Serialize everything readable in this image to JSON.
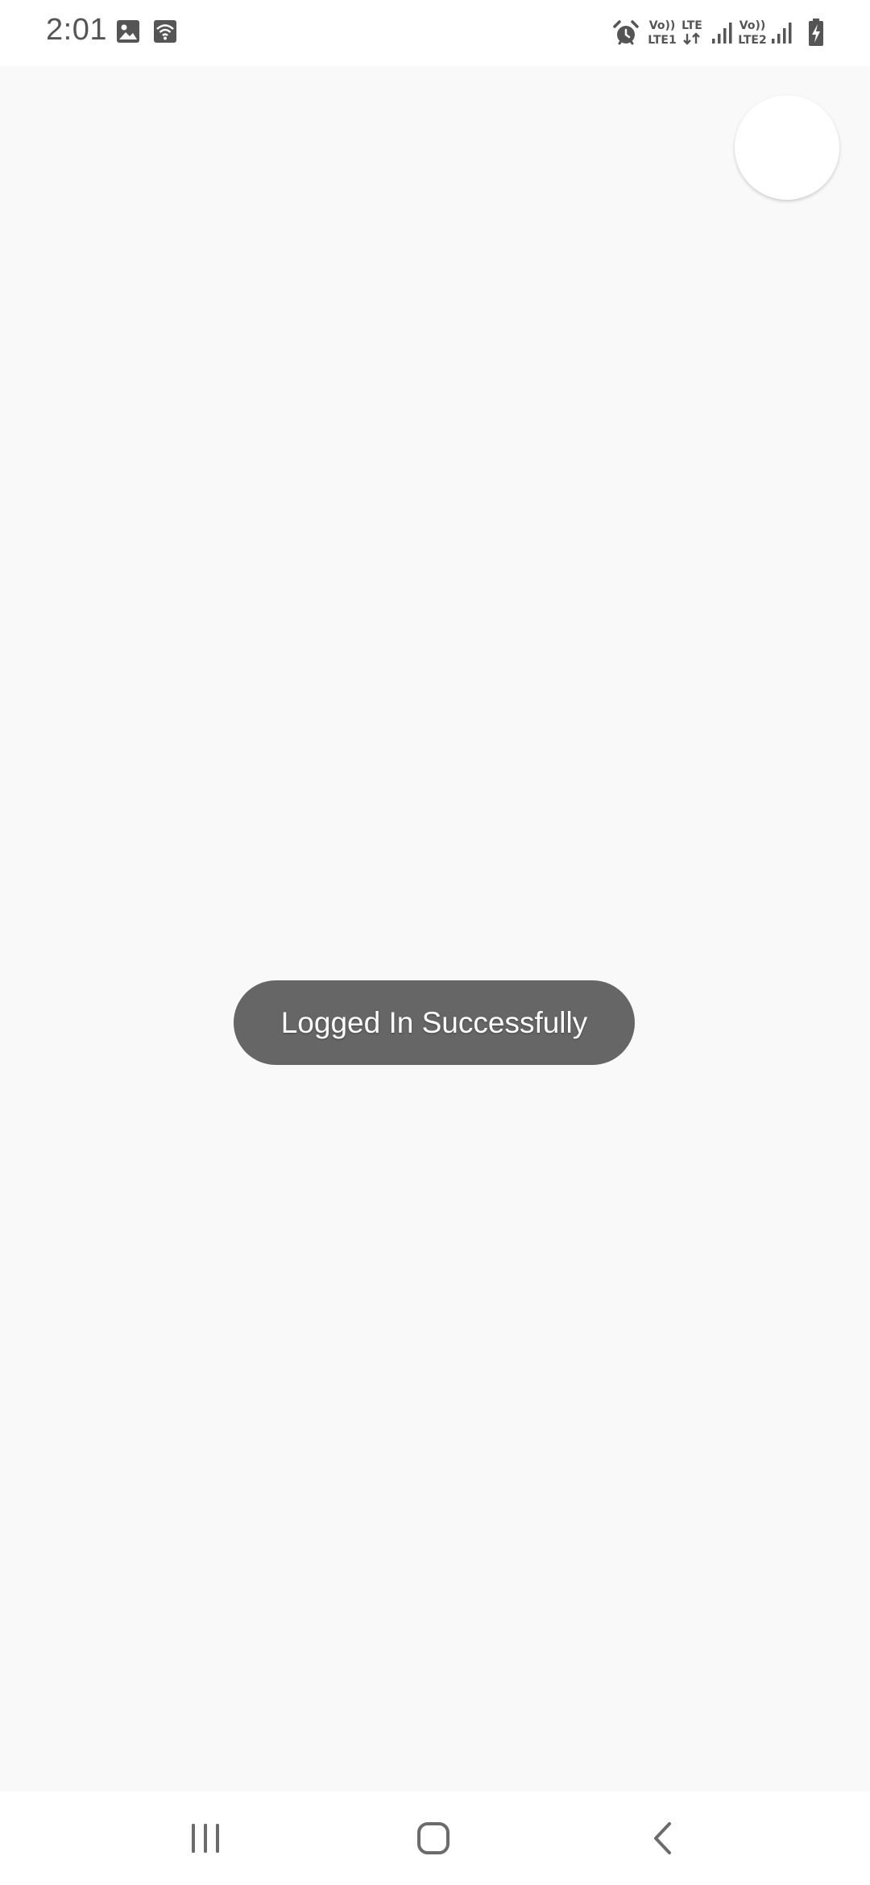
{
  "status_bar": {
    "time": "2:01",
    "left_icons": [
      "image-icon",
      "wifi-calling-icon"
    ],
    "right_icons": [
      "alarm-icon",
      "volte1-icon",
      "lte-data-icon",
      "signal-icon",
      "volte2-icon",
      "signal-icon",
      "battery-charging-icon"
    ],
    "volte1_top": "Vo))",
    "volte1_bottom": "LTE1",
    "lte_label": "LTE",
    "volte2_top": "Vo))",
    "volte2_bottom": "LTE2"
  },
  "toast": {
    "message": "Logged In Successfully"
  },
  "nav_bar": {
    "icons": [
      "recents-icon",
      "home-icon",
      "back-icon"
    ]
  },
  "colors": {
    "background": "#f9f9f9",
    "status_bar": "#ffffff",
    "toast_background": "#666666",
    "toast_text": "#ffffff",
    "icon": "#555555"
  }
}
